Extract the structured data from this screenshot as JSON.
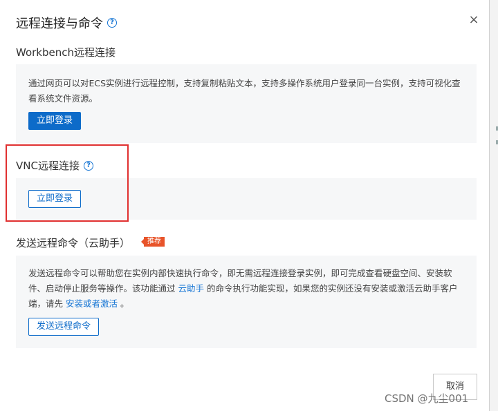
{
  "dialog": {
    "title": "远程连接与命令",
    "help_icon": "?",
    "close_icon": "×"
  },
  "workbench": {
    "heading": "Workbench远程连接",
    "description": "通过网页可以对ECS实例进行远程控制，支持复制粘贴文本，支持多操作系统用户登录同一台实例，支持可视化查看系统文件资源。",
    "login_button": "立即登录"
  },
  "vnc": {
    "heading": "VNC远程连接",
    "help_icon": "?",
    "login_button": "立即登录"
  },
  "send_command": {
    "heading": "发送远程命令（云助手）",
    "badge": "推荐",
    "description_part1": "发送远程命令可以帮助您在实例内部快速执行命令，即无需远程连接登录实例，即可完成查看硬盘空间、安装软件、启动停止服务等操作。该功能通过 ",
    "link_cloud_assistant": "云助手",
    "description_part2": " 的命令执行功能实现，如果您的实例还没有安装或激活云助手客户端，请先 ",
    "link_install": "安装或者激活",
    "description_part3": " 。",
    "button": "发送远程命令"
  },
  "footer": {
    "cancel_button": "取消"
  },
  "watermark": "CSDN @九尘001",
  "colors": {
    "primary": "#0d6bc9",
    "highlight": "#e03030",
    "badge": "#e8542a"
  }
}
